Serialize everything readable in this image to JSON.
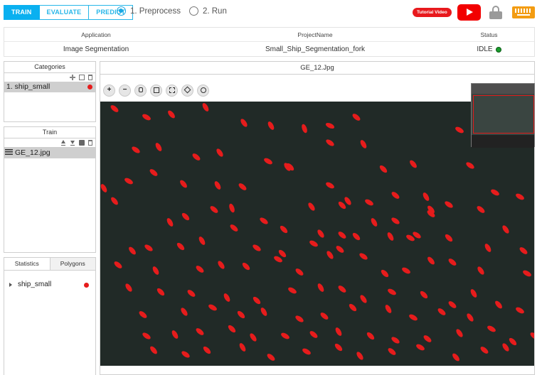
{
  "modes": [
    "TRAIN",
    "EVALUATE",
    "PREDICT"
  ],
  "steps": [
    "1. Preprocess",
    "2. Run"
  ],
  "tutorial_label": "Tutorial Video",
  "table": {
    "headers": [
      "Application",
      "ProjectName",
      "Status"
    ],
    "application": "Image Segmentation",
    "project": "Small_Ship_Segmentation_fork",
    "status": "IDLE"
  },
  "categories": {
    "title": "Categories",
    "items": [
      "1. ship_small"
    ]
  },
  "train": {
    "title": "Train",
    "file": "GE_12.jpg"
  },
  "stats": {
    "tabs": [
      "Statistics",
      "Polygons"
    ],
    "item": "ship_small"
  },
  "viewer": {
    "title": "GE_12.Jpg",
    "zoom_icons": [
      "zoom-in-icon",
      "zoom-out-icon",
      "hand-icon",
      "fit-icon",
      "zoom-rect-icon",
      "expand-icon",
      "reset-icon"
    ]
  },
  "colors": {
    "accent": "#0ab0f0",
    "annotation": "#e61c1c",
    "status_ok": "#1a9c2d",
    "youtube": "#f20000",
    "keyboard": "#f39c12"
  }
}
